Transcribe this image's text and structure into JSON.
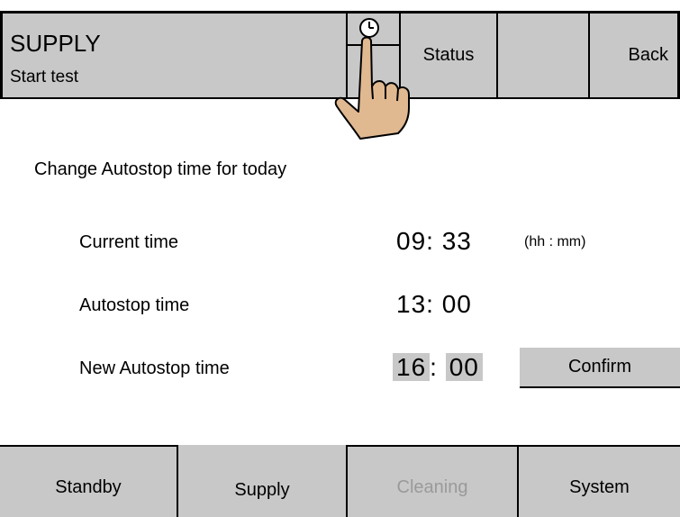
{
  "header": {
    "title": "SUPPLY",
    "subtitle": "Start test",
    "clock_icon": "clock-icon",
    "status_label": "Status",
    "back_label": "Back"
  },
  "main": {
    "heading": "Change Autostop time for today",
    "current_time": {
      "label": "Current time",
      "hh": "09",
      "mm": "33",
      "unit": "(hh : mm)"
    },
    "autostop_time": {
      "label": "Autostop time",
      "hh": "13",
      "mm": "00"
    },
    "new_autostop_time": {
      "label": "New Autostop time",
      "hh": "16",
      "mm": "00"
    },
    "confirm_label": "Confirm"
  },
  "tabs": [
    {
      "label": "Standby",
      "state": "normal"
    },
    {
      "label": "Supply",
      "state": "selected"
    },
    {
      "label": "Cleaning",
      "state": "disabled"
    },
    {
      "label": "System",
      "state": "normal"
    }
  ],
  "colors": {
    "panel_gray": "#c8c8c8",
    "disabled_text": "#9a9a9a",
    "hand_skin": "#e0b991"
  }
}
